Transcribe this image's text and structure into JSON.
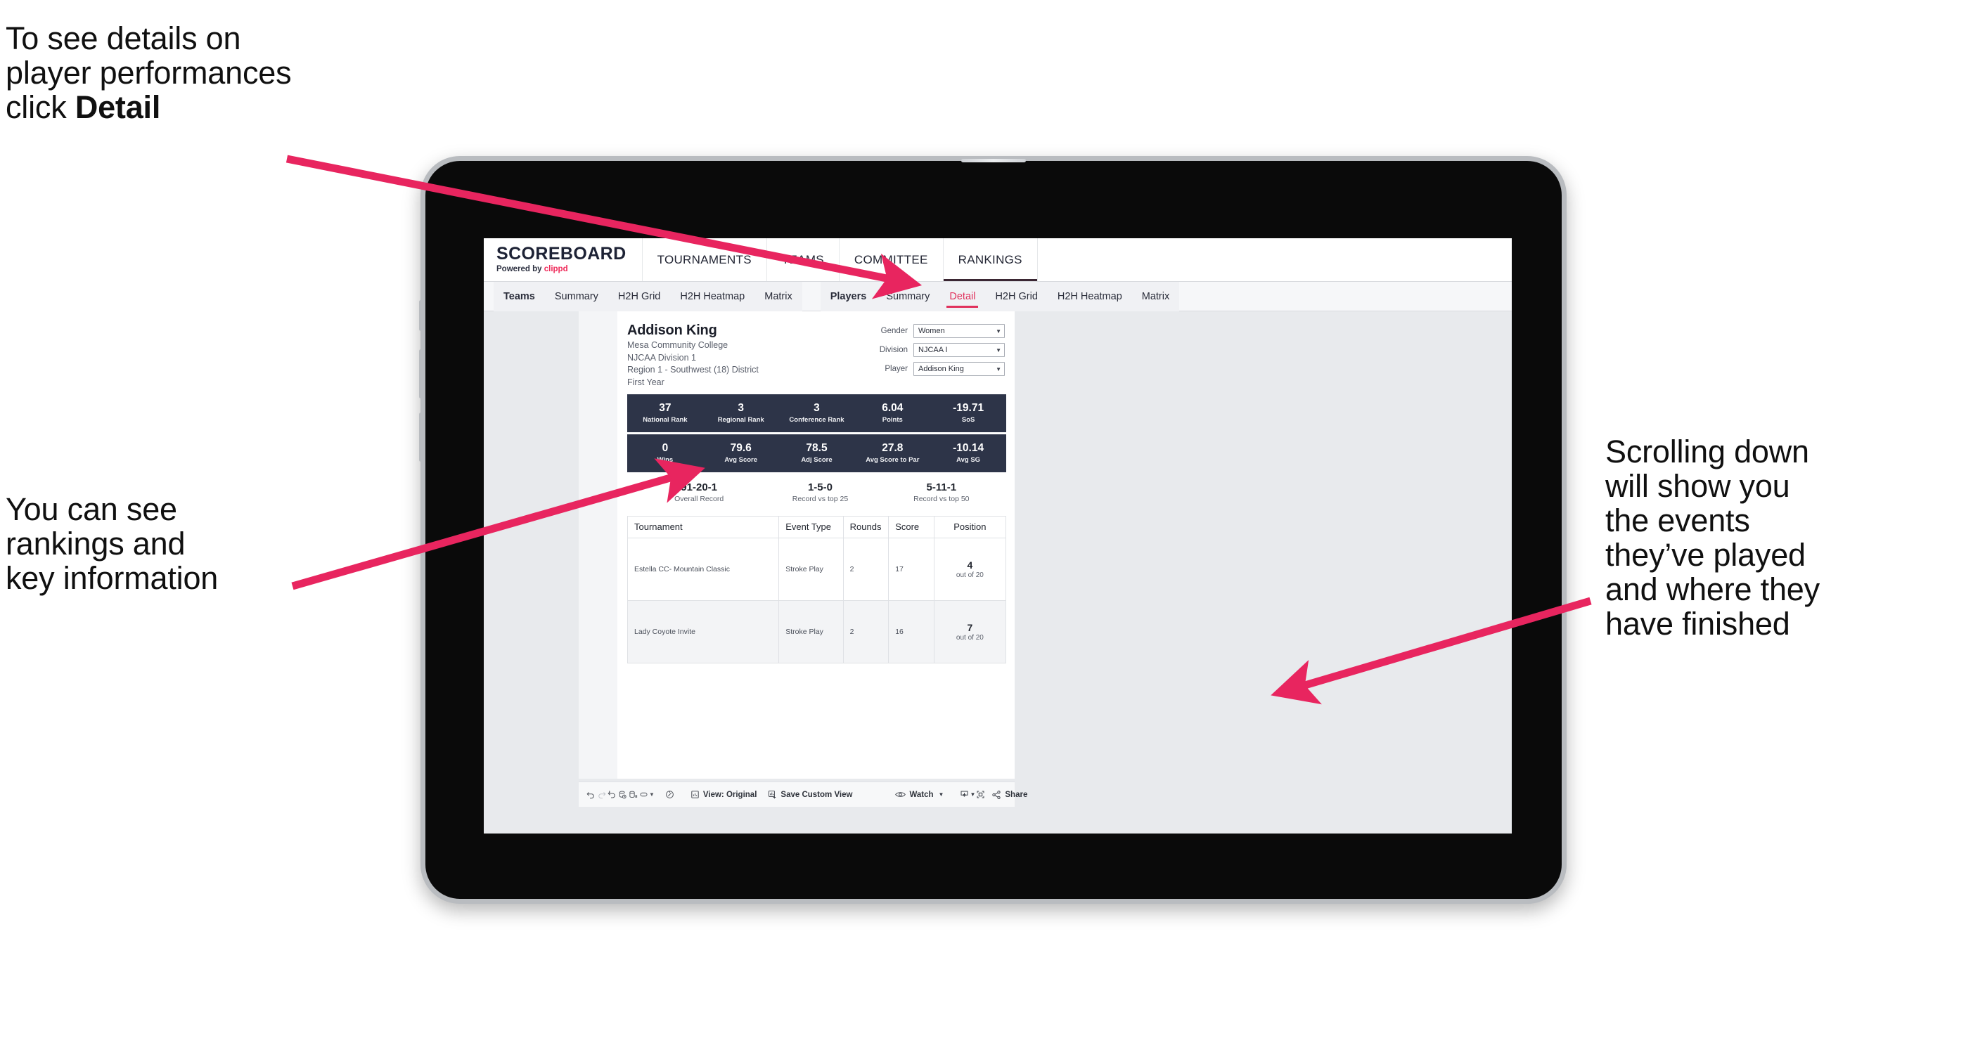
{
  "annotations": {
    "detail": {
      "line1": "To see details on",
      "line2": "player performances",
      "line3_pre": "click ",
      "line3_bold": "Detail"
    },
    "rankings": {
      "line1": "You can see",
      "line2": "rankings and",
      "line3": "key information"
    },
    "scroll": {
      "line1": "Scrolling down",
      "line2": "will show you",
      "line3": "the events",
      "line4": "they’ve played",
      "line5": "and where they",
      "line6": "have finished"
    }
  },
  "app": {
    "logo": {
      "main": "SCOREBOARD",
      "sub_pre": "Powered by ",
      "sub_brand": "clippd"
    },
    "topnav": [
      {
        "label": "TOURNAMENTS",
        "active": false
      },
      {
        "label": "TEAMS",
        "active": false
      },
      {
        "label": "COMMITTEE",
        "active": false
      },
      {
        "label": "RANKINGS",
        "active": true
      }
    ],
    "tabs_teams": [
      {
        "label": "Teams",
        "active": false,
        "head": true
      },
      {
        "label": "Summary",
        "active": false
      },
      {
        "label": "H2H Grid",
        "active": false
      },
      {
        "label": "H2H Heatmap",
        "active": false
      },
      {
        "label": "Matrix",
        "active": false
      }
    ],
    "tabs_players": [
      {
        "label": "Players",
        "active": false,
        "head": true
      },
      {
        "label": "Summary",
        "active": false
      },
      {
        "label": "Detail",
        "active": true
      },
      {
        "label": "H2H Grid",
        "active": false
      },
      {
        "label": "H2H Heatmap",
        "active": false
      },
      {
        "label": "Matrix",
        "active": false
      }
    ]
  },
  "player": {
    "name": "Addison King",
    "school": "Mesa Community College",
    "division": "NJCAA Division 1",
    "region": "Region 1 - Southwest (18) District",
    "year": "First Year"
  },
  "filters": [
    {
      "label": "Gender",
      "value": "Women"
    },
    {
      "label": "Division",
      "value": "NJCAA I"
    },
    {
      "label": "Player",
      "value": "Addison King"
    }
  ],
  "stats_band_1": [
    {
      "value": "37",
      "label": "National Rank"
    },
    {
      "value": "3",
      "label": "Regional Rank"
    },
    {
      "value": "3",
      "label": "Conference Rank"
    },
    {
      "value": "6.04",
      "label": "Points"
    },
    {
      "value": "-19.71",
      "label": "SoS"
    }
  ],
  "stats_band_2": [
    {
      "value": "0",
      "label": "Wins"
    },
    {
      "value": "79.6",
      "label": "Avg Score"
    },
    {
      "value": "78.5",
      "label": "Adj Score"
    },
    {
      "value": "27.8",
      "label": "Avg Score to Par"
    },
    {
      "value": "-10.14",
      "label": "Avg SG"
    }
  ],
  "records": [
    {
      "value": "91-20-1",
      "label": "Overall Record"
    },
    {
      "value": "1-5-0",
      "label": "Record vs top 25"
    },
    {
      "value": "5-11-1",
      "label": "Record vs top 50"
    }
  ],
  "table": {
    "columns": [
      "Tournament",
      "Event Type",
      "Rounds",
      "Score",
      "Position"
    ],
    "rows": [
      {
        "tournament": "Estella CC- Mountain Classic",
        "event_type": "Stroke Play",
        "rounds": "2",
        "score": "17",
        "position_value": "4",
        "position_label": "out of 20"
      },
      {
        "tournament": "Lady Coyote Invite",
        "event_type": "Stroke Play",
        "rounds": "2",
        "score": "16",
        "position_value": "7",
        "position_label": "out of 20"
      }
    ]
  },
  "toolbar": {
    "view_label": "View: Original",
    "save_label": "Save Custom View",
    "watch_label": "Watch",
    "share_label": "Share"
  },
  "colors": {
    "accent_pink": "#e8255f",
    "brand_red": "#ef2b5a",
    "band_navy": "#2d3448",
    "tab_active": "#e0315c"
  }
}
